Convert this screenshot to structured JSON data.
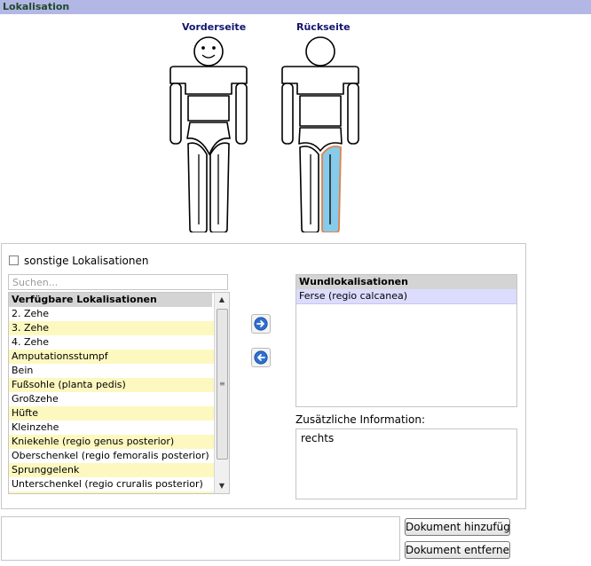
{
  "header": {
    "title": "Lokalisation"
  },
  "figures": {
    "front_label": "Vorderseite",
    "back_label": "Rückseite"
  },
  "colors": {
    "highlight_fill": "#87cbea",
    "highlight_stroke": "#e0814a",
    "alt_row": "#fdf8c0",
    "selected_row": "#dcdcff"
  },
  "options": {
    "other_label": "sonstige Lokalisationen",
    "other_checked": false
  },
  "search": {
    "placeholder": "Suchen..."
  },
  "available": {
    "header": "Verfügbare Lokalisationen",
    "items": [
      "2. Zehe",
      "3. Zehe",
      "4. Zehe",
      "Amputationsstumpf",
      "Bein",
      "Fußsohle (planta pedis)",
      "Großzehe",
      "Hüfte",
      "Kleinzehe",
      "Kniekehle (regio genus posterior)",
      "Oberschenkel (regio femoralis posterior)",
      "Sprunggelenk",
      "Unterschenkel (regio cruralis posterior)"
    ]
  },
  "wound": {
    "header": "Wundlokalisationen",
    "items": [
      "Ferse (regio calcanea)"
    ]
  },
  "info": {
    "label": "Zusätzliche Information:",
    "value": "rechts"
  },
  "documents": {
    "add_label": "Dokument hinzufügen",
    "remove_label": "Dokument entfernen"
  },
  "icons": {
    "add": "arrow-right-icon",
    "remove": "arrow-left-icon"
  }
}
